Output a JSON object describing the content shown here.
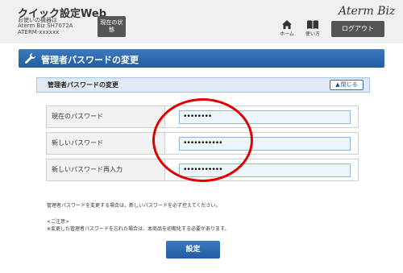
{
  "header": {
    "title": "クイック設定Web",
    "device_label": "お使いの機器は",
    "device_model": "Aterm Biz SH7072A",
    "device_id": "ATERM-xxxxxx",
    "status_button": "現在の状態",
    "home_label": "ホーム",
    "guide_label": "使い方",
    "brand": "Aterm Biz",
    "logout_button": "ログアウト"
  },
  "section": {
    "title": "管理者パスワードの変更"
  },
  "subpanel": {
    "title": "管理者パスワードの変更",
    "collapse_label": "閉じる"
  },
  "form": {
    "rows": [
      {
        "label": "現在のパスワード",
        "value": "••••••••"
      },
      {
        "label": "新しいパスワード",
        "value": "•••••••••••"
      },
      {
        "label": "新しいパスワード再入力",
        "value": "•••••••••••"
      }
    ]
  },
  "notes": {
    "line1": "管理者パスワードを変更する場合は、新しいパスワードを必ず控えてください。",
    "line2": "<ご注意>",
    "line3": "※変更した管理者パスワードを忘れた場合は、本商品を初期化する必要があります。"
  },
  "submit_label": "設定",
  "colors": {
    "accent": "#2a67ad",
    "highlight": "#e10000",
    "header_bg": "#f0f0f0"
  }
}
